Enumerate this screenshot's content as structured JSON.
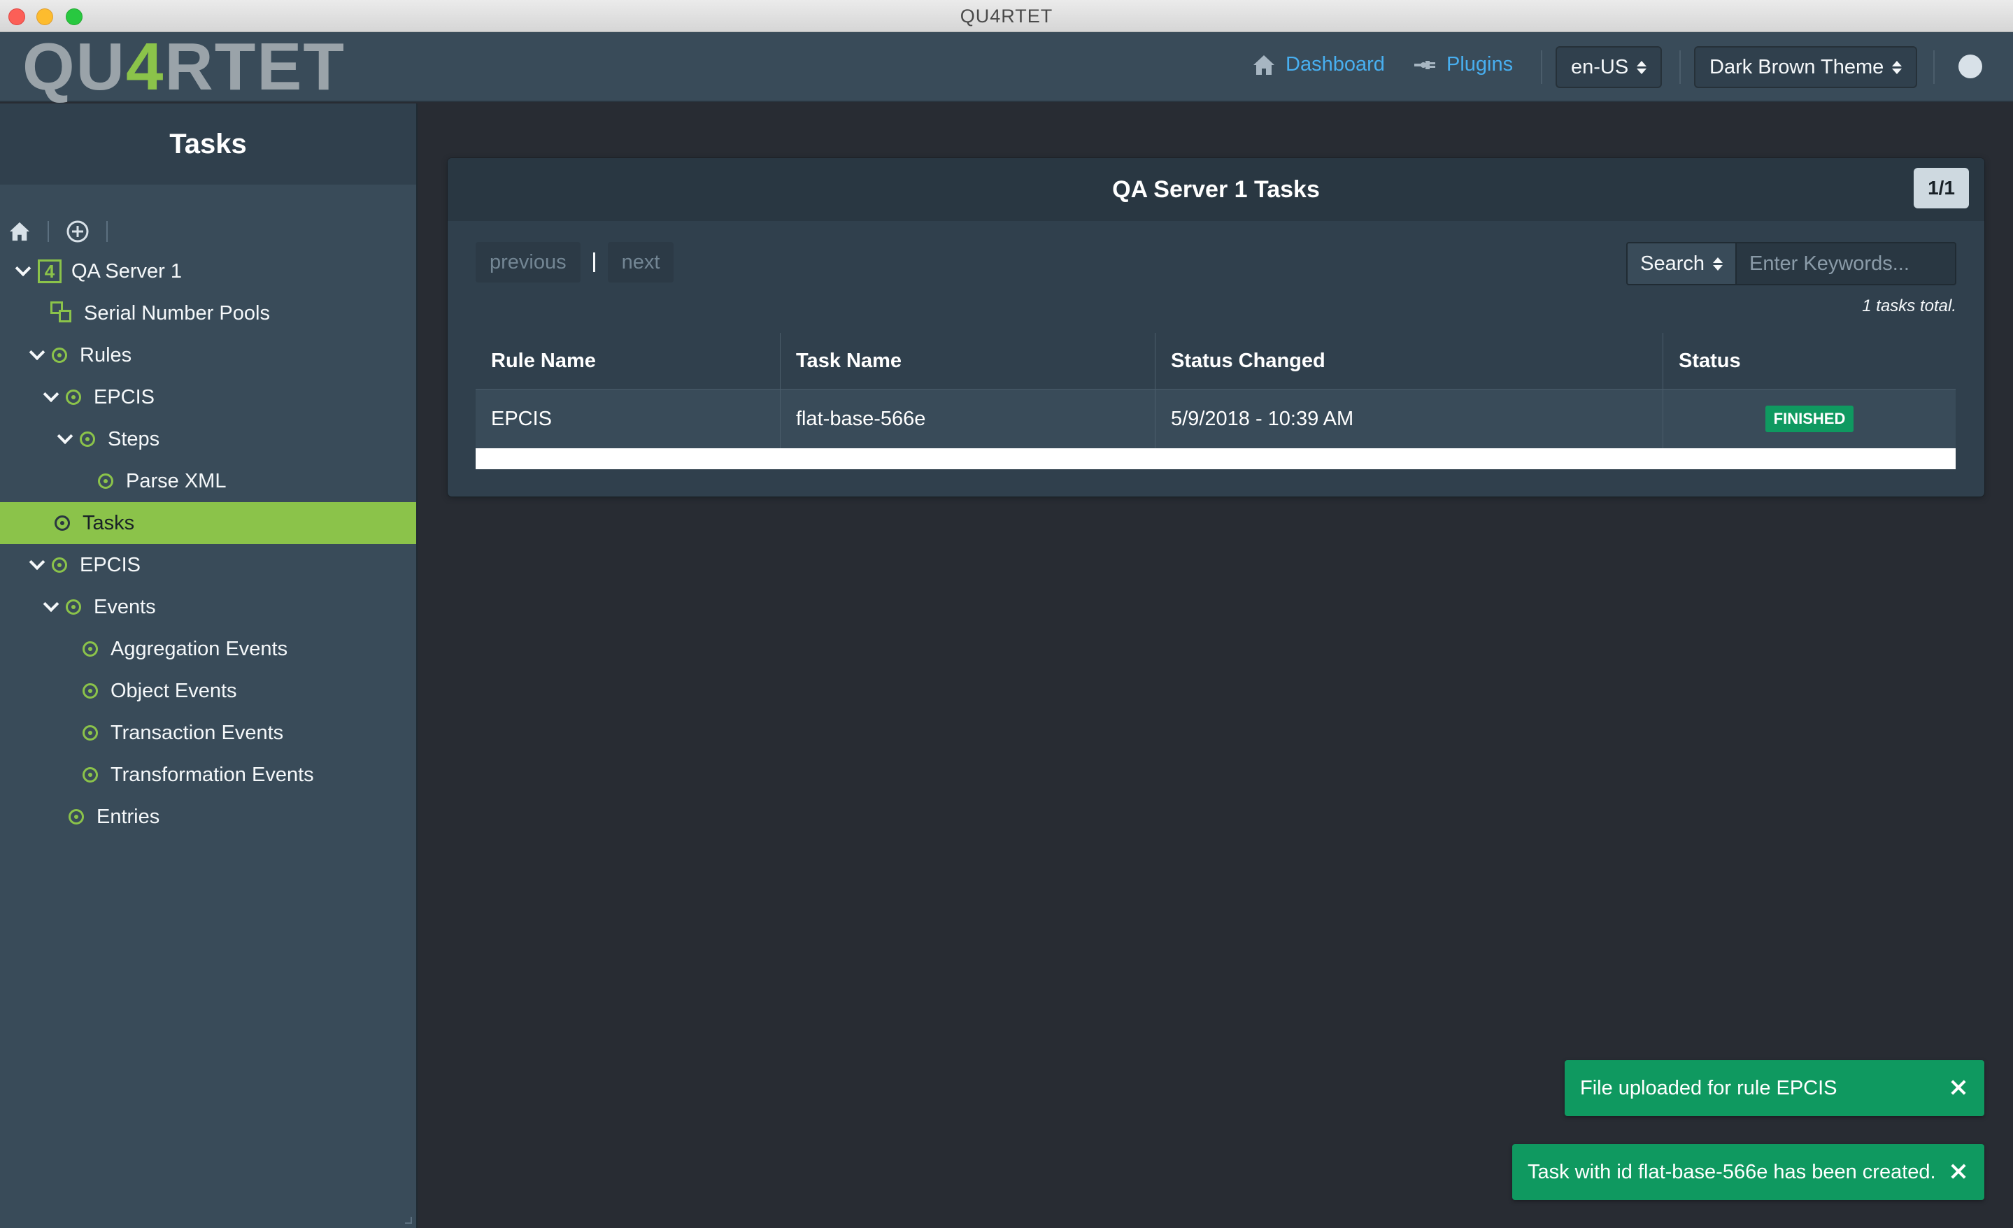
{
  "window": {
    "title": "QU4RTET"
  },
  "navbar": {
    "logo_prefix": "QU",
    "logo_accent": "4",
    "logo_suffix": "RTET",
    "dashboard_label": "Dashboard",
    "plugins_label": "Plugins",
    "locale_value": "en-US",
    "theme_value": "Dark Brown Theme"
  },
  "sidebar": {
    "title": "Tasks",
    "tree": [
      {
        "label": "QA Server 1",
        "icon": "server-icon",
        "expanded": true
      },
      {
        "label": "Serial Number Pools",
        "icon": "pool-icon"
      },
      {
        "label": "Rules",
        "expanded": true
      },
      {
        "label": "EPCIS",
        "expanded": true
      },
      {
        "label": "Steps",
        "expanded": true
      },
      {
        "label": "Parse XML"
      },
      {
        "label": "Tasks",
        "selected": true
      },
      {
        "label": "EPCIS",
        "expanded": true
      },
      {
        "label": "Events",
        "expanded": true
      },
      {
        "label": "Aggregation Events"
      },
      {
        "label": "Object Events"
      },
      {
        "label": "Transaction Events"
      },
      {
        "label": "Transformation Events"
      },
      {
        "label": "Entries"
      }
    ]
  },
  "main": {
    "card_title": "QA Server 1 Tasks",
    "page_indicator": "1/1",
    "previous_label": "previous",
    "next_label": "next",
    "search_label": "Search",
    "search_placeholder": "Enter Keywords...",
    "total_text": "1 tasks total.",
    "columns": [
      "Rule Name",
      "Task Name",
      "Status Changed",
      "Status"
    ],
    "rows": [
      {
        "rule_name": "EPCIS",
        "task_name": "flat-base-566e",
        "status_changed": "5/9/2018 - 10:39 AM",
        "status": "FINISHED"
      }
    ]
  },
  "toasts": [
    {
      "message": "File uploaded for rule EPCIS"
    },
    {
      "message": "Task with id flat-base-566e has been created."
    }
  ],
  "colors": {
    "accent_green": "#8bc34a",
    "link_blue": "#48aff0",
    "success_green": "#0f9960"
  }
}
